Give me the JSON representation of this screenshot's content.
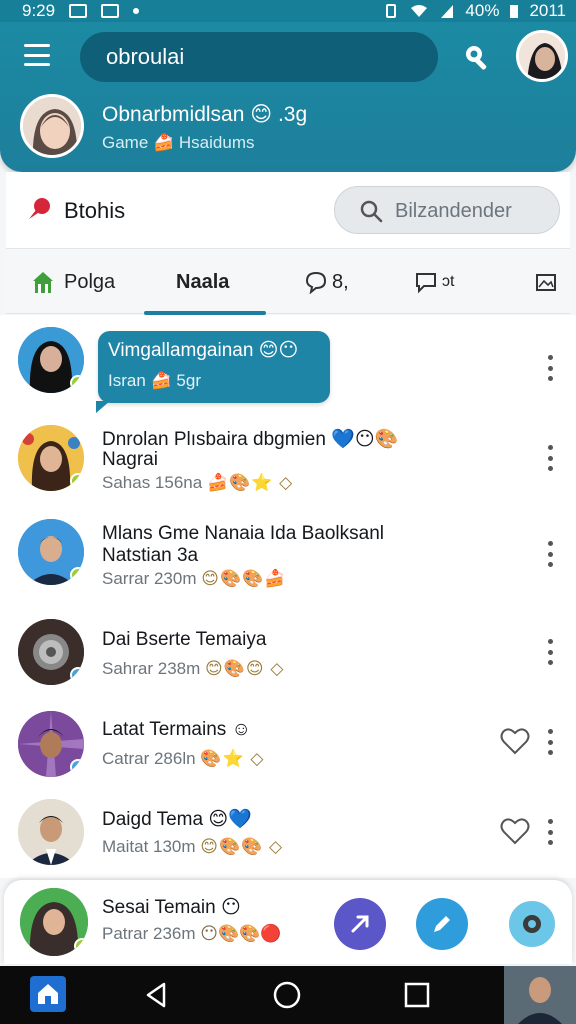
{
  "status_bar": {
    "time": "9:29",
    "battery": "40%",
    "extra": "2011"
  },
  "header": {
    "search_text": "obroulai",
    "profile": {
      "name": "Obnarbmidlsan 😊 .3g",
      "subtitle": "Game 🍰 Hsaidums"
    }
  },
  "title_bar": {
    "title": "Btohis",
    "search_placeholder": "Bilzandender"
  },
  "tabs": [
    {
      "label": "Polga",
      "icon": "house-icon"
    },
    {
      "label": "Naala",
      "icon": ""
    },
    {
      "label": "8,",
      "icon": "chat-bubble-icon"
    },
    {
      "label": "ɔt",
      "icon": "message-square-icon"
    },
    {
      "label": "",
      "icon": "image-icon"
    }
  ],
  "chats": [
    {
      "name": "Vimgallamgainan 😊😶",
      "meta": "Isran 🍰 5gr",
      "highlighted": true
    },
    {
      "name": "Dnrolan Plısbaira dbgmien 💙😶🎨",
      "name2": "Nagrai",
      "meta": "Sahas 156na",
      "emoji": "🍰🎨⭐ ◇"
    },
    {
      "name": "Mlans Gme Nanaia Ida Baolksanl",
      "name2": "Natstian 3a",
      "meta": "Sarrar 230m",
      "emoji": "😊🎨🎨🍰"
    },
    {
      "name": "Dai Bserte Temaiya",
      "meta": "Sahrar 238m",
      "emoji": "😊🎨😊 ◇"
    },
    {
      "name": "Latat Termains ☺",
      "meta": "Catrar 286ln",
      "emoji": "🎨⭐ ◇"
    },
    {
      "name": "Daigd Tema 😊💙",
      "meta": "Maitat 130m",
      "emoji": "😊🎨🎨 ◇"
    }
  ],
  "bottom_card": {
    "name": "Sesai Temain 😶",
    "meta": "Patrar 236m",
    "emoji": "😶🎨🎨🔴"
  },
  "colors": {
    "primary": "#1c8aa3",
    "accent": "#1f85a6",
    "online": "#9ccc3a",
    "fab_purple": "#5b57c9",
    "fab_blue": "#2f9ddb",
    "fab_light": "#4cb9e0"
  }
}
